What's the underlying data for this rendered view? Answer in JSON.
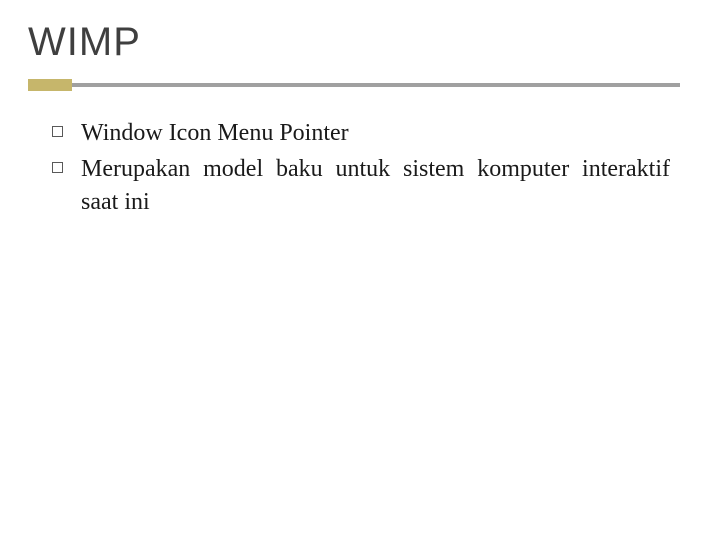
{
  "slide": {
    "title": "WIMP",
    "bullets": [
      "Window Icon Menu Pointer",
      "Merupakan model baku untuk sistem komputer interaktif saat ini"
    ]
  }
}
